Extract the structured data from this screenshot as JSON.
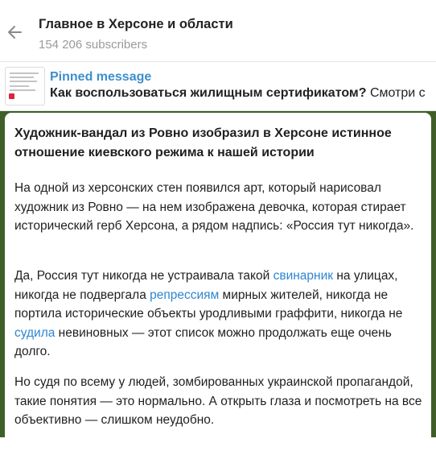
{
  "header": {
    "title": "Главное в Херсоне и области",
    "subscribers": "154 206 subscribers"
  },
  "pinned": {
    "label": "Pinned message",
    "text_bold": "Как воспользоваться жилищным сертификатом?",
    "text_rest": " Смотри с"
  },
  "message": {
    "title": "Художник-вандал из Ровно изобразил в Херсоне истинное отношение киевского режима к нашей истории",
    "p1": "На одной из херсонских стен появился арт, который нарисовал художник из Ровно — на нем изображена девочка, которая стирает исторический герб Херсона, а рядом надпись: «Россия тут никогда».",
    "p2": {
      "t1": "Да, Россия тут никогда не устраивала такой ",
      "link1": "свинарник",
      "t2": " на улицах, никогда не подвергала ",
      "link2": "репрессиям",
      "t3": " мирных жителей, никогда не портила исторические объекты уродливыми граффити, никогда не ",
      "link3": "судила",
      "t4": " невиновных — этот список можно продолжать еще очень долго."
    },
    "p3": "Но судя по всему у людей, зомбированных украинской пропагандой, такие понятия — это нормально. А открыть глаза и посмотреть на все объективно — слишком неудобно."
  },
  "icons": {
    "back": "arrow-left-icon",
    "thumbnail": "pinned-image-thumbnail"
  },
  "colors": {
    "link": "#2e86d1",
    "pinned_label": "#3d8fcc",
    "chat_background": "#3f5e28",
    "muted_text": "#9a9a9a"
  }
}
